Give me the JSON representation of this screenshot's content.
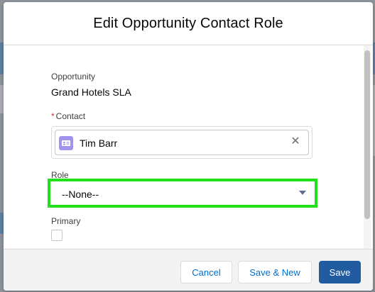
{
  "modal": {
    "title": "Edit Opportunity Contact Role"
  },
  "fields": {
    "opportunity": {
      "label": "Opportunity",
      "value": "Grand Hotels SLA"
    },
    "contact": {
      "required_marker": "*",
      "label": "Contact",
      "value": "Tim Barr",
      "icon": "contact-card-icon",
      "remove_icon": "close-icon",
      "remove_glyph": "✕"
    },
    "role": {
      "label": "Role",
      "selected": "--None--",
      "highlight_color": "#22e01c"
    },
    "primary": {
      "label": "Primary",
      "checked": false
    }
  },
  "footer": {
    "cancel_label": "Cancel",
    "save_new_label": "Save & New",
    "save_label": "Save"
  },
  "colors": {
    "brand": "#215ca0",
    "link": "#0070d2",
    "required": "#c23934",
    "contact_icon_bg": "#a094ed"
  }
}
